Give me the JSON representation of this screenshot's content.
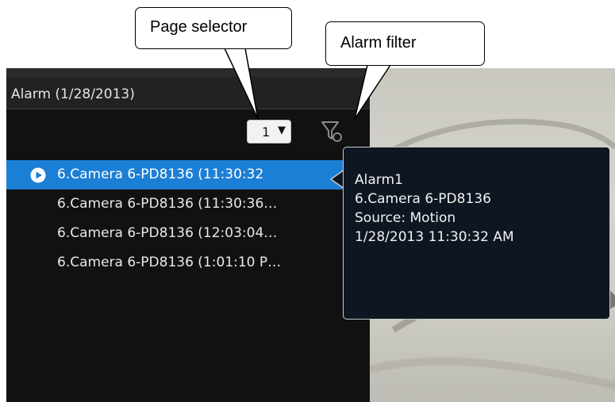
{
  "callouts": {
    "page_selector": "Page selector",
    "alarm_filter": "Alarm filter"
  },
  "alarm_panel": {
    "title": "Alarm (1/28/2013)",
    "page_select": {
      "value": "1",
      "arrow": "▼"
    },
    "filter_icon": "filter-icon",
    "items": [
      {
        "label": "6.Camera 6-PD8136 (11:30:32",
        "selected": true,
        "icon": "play-icon"
      },
      {
        "label": "6.Camera 6-PD8136 (11:30:36…",
        "selected": false
      },
      {
        "label": "6.Camera 6-PD8136 (12:03:04…",
        "selected": false
      },
      {
        "label": "6.Camera 6-PD8136 (1:01:10 P…",
        "selected": false
      }
    ]
  },
  "tooltip": {
    "lines": [
      "Alarm1",
      "6.Camera 6-PD8136",
      "Source: Motion",
      "1/28/2013 11:30:32 AM"
    ]
  },
  "colors": {
    "selected_row": "#1c7fd6",
    "panel_bg": "#111111",
    "tooltip_bg": "#0e1622"
  }
}
